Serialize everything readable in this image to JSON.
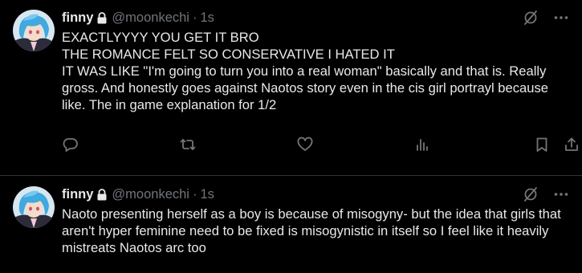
{
  "tweets": [
    {
      "name": "finny",
      "handle": "@moonkechi",
      "separator": "·",
      "time": "1s",
      "text": "EXACTLYYYY YOU GET IT BRO\nTHE ROMANCE FELT SO CONSERVATIVE I HATED IT\nIT WAS LIKE \"I'm going to turn you into a real woman\" basically and that is. Really gross. And honestly goes against Naotos story even in the cis girl portrayl because like. The in game explanation for 1/2"
    },
    {
      "name": "finny",
      "handle": "@moonkechi",
      "separator": "·",
      "time": "1s",
      "text": "Naoto presenting herself as a boy is because of misogyny- but the idea that girls that aren't hyper feminine need to be fixed is misogynistic in itself so I feel like it heavily mistreats Naotos arc too"
    }
  ],
  "icons": {
    "protected": "lock-icon",
    "grok": "grok-icon",
    "more": "more-icon",
    "reply": "reply-icon",
    "repost": "repost-icon",
    "like": "like-icon",
    "views": "views-icon",
    "bookmark": "bookmark-icon",
    "share": "share-icon"
  },
  "colors": {
    "background": "#000000",
    "text": "#e7e9ea",
    "secondary": "#71767b",
    "divider": "#2f3336"
  }
}
